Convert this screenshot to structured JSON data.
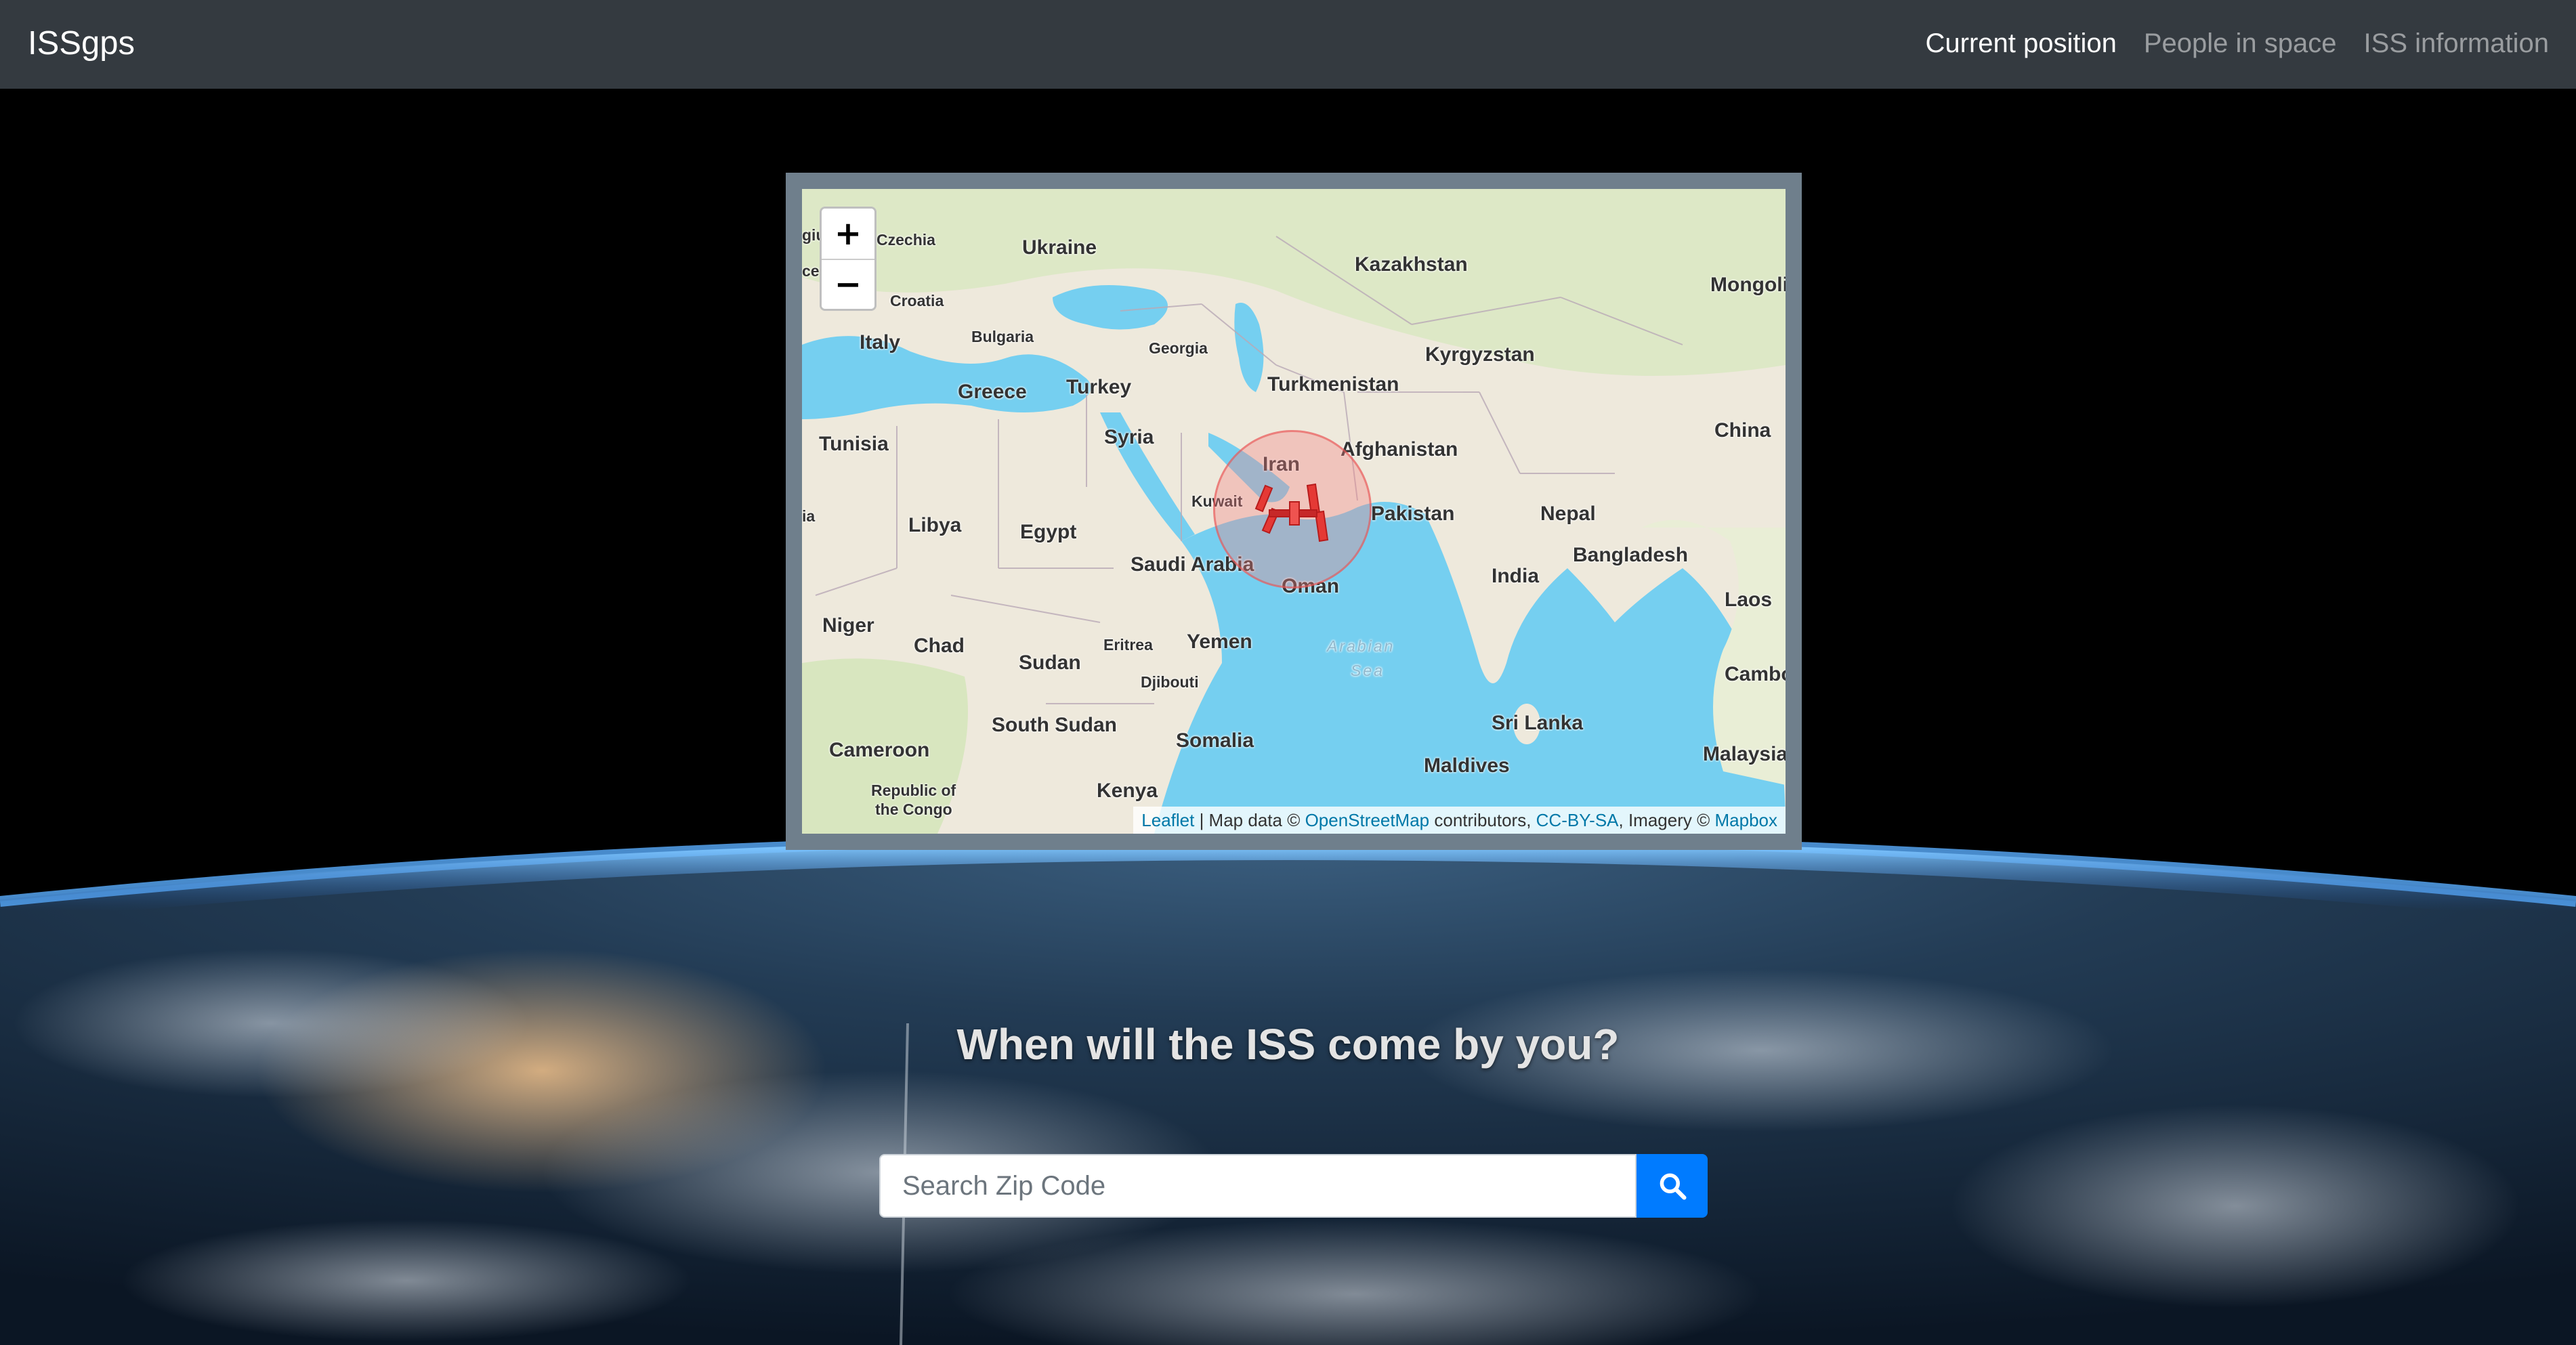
{
  "navbar": {
    "brand": "ISSgps",
    "links": [
      {
        "label": "Current position",
        "active": true
      },
      {
        "label": "People in space",
        "active": false
      },
      {
        "label": "ISS information",
        "active": false
      }
    ]
  },
  "map": {
    "zoom_in": "+",
    "zoom_out": "−",
    "attribution": {
      "leaflet": "Leaflet",
      "sep1": " | Map data © ",
      "osm": "OpenStreetMap",
      "sep2": " contributors, ",
      "license": "CC-BY-SA",
      "sep3": ", Imagery © ",
      "mapbox": "Mapbox"
    },
    "labels": {
      "czechia": "Czechia",
      "ukraine": "Ukraine",
      "kazakhstan": "Kazakhstan",
      "mongolia": "Mongoli",
      "croatia": "Croatia",
      "italy": "Italy",
      "bulgaria": "Bulgaria",
      "georgia": "Georgia",
      "kyrgyzstan": "Kyrgyzstan",
      "greece": "Greece",
      "turkey": "Turkey",
      "turkmenistan": "Turkmenistan",
      "tunisia": "Tunisia",
      "syria": "Syria",
      "afghanistan": "Afghanistan",
      "china": "China",
      "iran": "Iran",
      "kuwait": "Kuwait",
      "pakistan": "Pakistan",
      "nepal": "Nepal",
      "libya": "Libya",
      "egypt": "Egypt",
      "saudi_arabia": "Saudi Arabia",
      "bangladesh": "Bangladesh",
      "india": "India",
      "oman": "Oman",
      "laos": "Laos",
      "niger": "Niger",
      "chad": "Chad",
      "eritrea": "Eritrea",
      "yemen": "Yemen",
      "arabian_sea_1": "Arabian",
      "arabian_sea_2": "Sea",
      "sudan": "Sudan",
      "djibouti": "Djibouti",
      "cambodia": "Cambo",
      "south_sudan": "South Sudan",
      "sri_lanka": "Sri Lanka",
      "cameroon": "Cameroon",
      "somalia": "Somalia",
      "maldives": "Maldives",
      "malaysia": "Malaysia",
      "congo_1": "Republic of",
      "congo_2": "the Congo",
      "kenya": "Kenya",
      "edge_ce": "ce",
      "edge_ia": "ia",
      "edge_giu": "giu"
    }
  },
  "headline": "When will the ISS come by you?",
  "search": {
    "placeholder": "Search Zip Code",
    "icon": "search-icon"
  },
  "colors": {
    "navbar": "#343a40",
    "primary": "#007bff",
    "water": "#75cff0",
    "land": "#eee9dc"
  }
}
